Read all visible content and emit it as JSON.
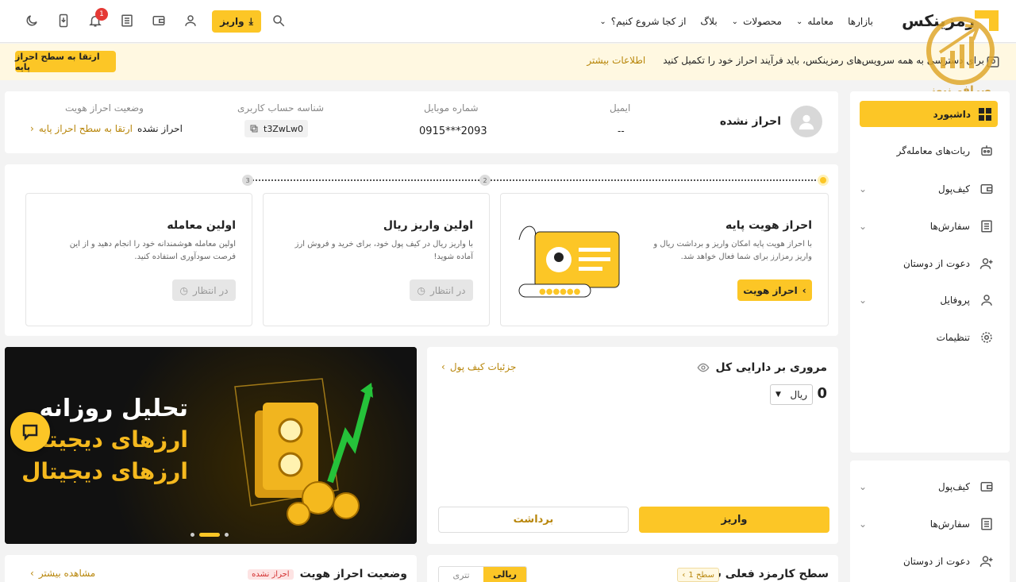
{
  "header": {
    "logo": "رمزینکس",
    "nav": [
      {
        "label": "بازارها",
        "has_chevron": false
      },
      {
        "label": "معامله",
        "has_chevron": true
      },
      {
        "label": "محصولات",
        "has_chevron": true
      },
      {
        "label": "بلاگ",
        "has_chevron": false
      },
      {
        "label": "از کجا شروع کنیم؟",
        "has_chevron": true
      }
    ],
    "deposit_label": "واریز",
    "notification_count": "1"
  },
  "banner": {
    "text_prefix": "برای دسترسی به همه سرویس‌های رمزینکس، باید فرآیند احراز خود را تکمیل کنید",
    "more_link": "اطلاعات بیشتر",
    "upgrade_button": "ارتقا به سطح احراز پایه"
  },
  "watermark": "صرافی‌نیوز",
  "sidebar": {
    "items": [
      {
        "label": "داشبورد",
        "active": true,
        "chevron": false,
        "icon": "grid-icon"
      },
      {
        "label": "ربات‌های معامله‌گر",
        "active": false,
        "chevron": false,
        "icon": "robot-icon"
      },
      {
        "label": "کیف‌پول",
        "active": false,
        "chevron": true,
        "icon": "wallet-icon"
      },
      {
        "label": "سفارش‌ها",
        "active": false,
        "chevron": true,
        "icon": "orders-icon"
      },
      {
        "label": "دعوت از دوستان",
        "active": false,
        "chevron": false,
        "icon": "invite-icon"
      },
      {
        "label": "پروفایل",
        "active": false,
        "chevron": true,
        "icon": "user-icon"
      },
      {
        "label": "تنظیمات",
        "active": false,
        "chevron": false,
        "icon": "gear-icon"
      }
    ],
    "items2": [
      {
        "label": "کیف‌پول",
        "chevron": true,
        "icon": "wallet-icon"
      },
      {
        "label": "سفارش‌ها",
        "chevron": true,
        "icon": "orders-icon"
      },
      {
        "label": "دعوت از دوستان",
        "chevron": false,
        "icon": "invite-icon"
      }
    ]
  },
  "profile": {
    "status": "احراز نشده",
    "email_label": "ایمیل",
    "email_value": "--",
    "mobile_label": "شماره موبایل",
    "mobile_value": "0915***2093",
    "account_id_label": "شناسه حساب کاربری",
    "account_id_value": "t3ZwLw0",
    "kyc_label": "وضعیت احراز هویت",
    "kyc_value": "احراز نشده",
    "kyc_link": "ارتقا به سطح احراز پایه"
  },
  "steps": {
    "numbers": [
      "2",
      "3"
    ],
    "cards": [
      {
        "title": "احراز هویت پایه",
        "desc": "با احراز هویت پایه امکان واریز و برداشت ریال و واریز رمزارز برای شما فعال خواهد شد.",
        "button": "احراز هویت"
      },
      {
        "title": "اولین واریز ریال",
        "desc": "با واریز ریال در کیف پول خود، برای خرید و فروش ارز آماده شوید!",
        "button": "در انتظار"
      },
      {
        "title": "اولین معامله",
        "desc": "اولین معامله هوشمندانه خود را انجام دهید و از این فرصت سودآوری استفاده کنید.",
        "button": "در انتظار"
      }
    ]
  },
  "assets": {
    "title": "مروری بر دارایی کل",
    "details_link": "جزئیات کیف پول",
    "amount": "0",
    "currency": "ریال",
    "deposit": "واریز",
    "withdraw": "برداشت"
  },
  "promo": {
    "line1": "تحلیل روزانه",
    "line2": "ارزهای دیجیتال",
    "line3": "ارزهای دیجیتال"
  },
  "fee": {
    "title": "سطح کارمزد فعلی شما",
    "level": "سطح 1",
    "tab_rial": "ریالی",
    "tab_tether": "تتری"
  },
  "kyc_bottom": {
    "title": "وضعیت احراز هویت",
    "badge": "احراز نشده",
    "link": "مشاهده بیشتر"
  },
  "colors": {
    "accent": "#fcc626",
    "gold_text": "#b8860b",
    "dark_promo": "#1a1a1a"
  }
}
